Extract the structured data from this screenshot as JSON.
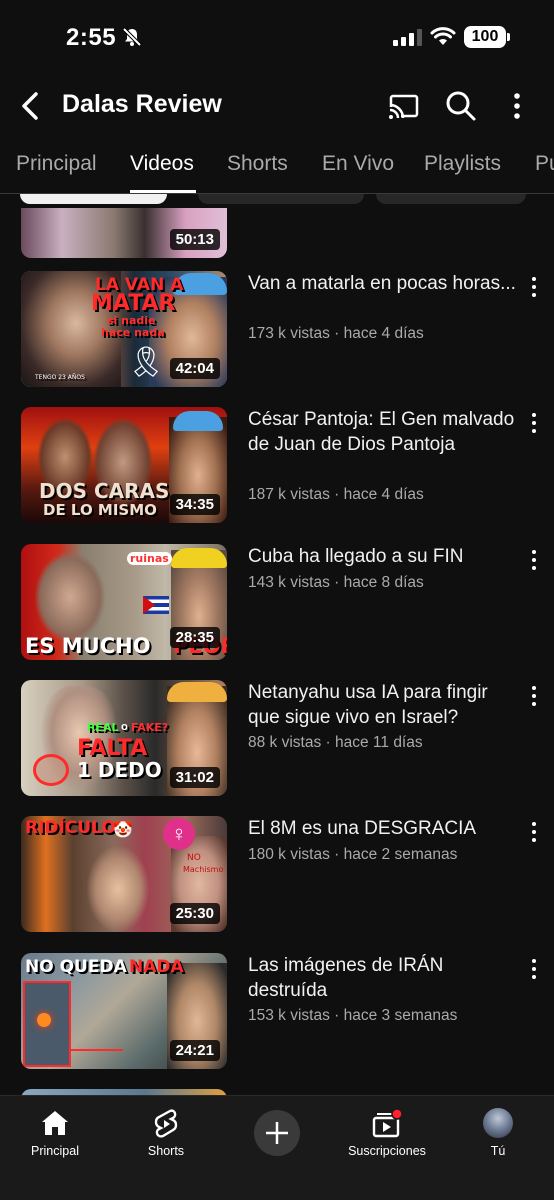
{
  "status_bar": {
    "time": "2:55",
    "battery": "100"
  },
  "header": {
    "channel_name": "Dalas Review"
  },
  "tabs": [
    {
      "label": "Principal",
      "active": false
    },
    {
      "label": "Videos",
      "active": true
    },
    {
      "label": "Shorts",
      "active": false
    },
    {
      "label": "En Vivo",
      "active": false
    },
    {
      "label": "Playlists",
      "active": false
    },
    {
      "label": "Pu",
      "active": false
    }
  ],
  "videos": [
    {
      "title": "",
      "meta": "",
      "duration": "50:13"
    },
    {
      "title": "Van a matarla en pocas horas...",
      "meta": "173 k vistas · hace 4 días",
      "duration": "42:04",
      "thumb_text": [
        "LA VAN A",
        "MATAR",
        "si nadie",
        "hace nada",
        "TENGO 23 AÑOS"
      ]
    },
    {
      "title": "César Pantoja: El Gen malvado de Juan de Dios Pantoja",
      "meta": "187 k vistas · hace 4 días",
      "duration": "34:35",
      "thumb_text": [
        "DOS CARAS",
        "DE LO MISMO"
      ]
    },
    {
      "title": "Cuba ha llegado a su FIN",
      "meta": "143 k vistas · hace 8 días",
      "duration": "28:35",
      "thumb_text": [
        "ES MUCHO",
        "PEOR",
        "ruinas"
      ]
    },
    {
      "title": "Netanyahu usa IA para fingir que sigue vivo en Israel?",
      "meta": "88 k vistas · hace 11 días",
      "duration": "31:02",
      "thumb_text": [
        "REAL",
        "O",
        "FAKE?",
        "FALTA",
        "1 DEDO"
      ]
    },
    {
      "title": "El 8M es una DESGRACIA",
      "meta": "180 k vistas · hace 2 semanas",
      "duration": "25:30",
      "thumb_text": [
        "RIDÍCULOS",
        "NO",
        "Machismo"
      ]
    },
    {
      "title": "Las imágenes de IRÁN destruída",
      "meta": "153 k vistas · hace 3 semanas",
      "duration": "24:21",
      "thumb_text": [
        "NO QUEDA",
        "NADA"
      ]
    }
  ],
  "bottom_nav": [
    {
      "label": "Principal",
      "icon": "home-icon"
    },
    {
      "label": "Shorts",
      "icon": "shorts-icon"
    },
    {
      "label": "",
      "icon": "plus-icon"
    },
    {
      "label": "Suscripciones",
      "icon": "subscriptions-icon"
    },
    {
      "label": "Tú",
      "icon": "avatar"
    }
  ],
  "colors": {
    "background": "#0f0f0f",
    "secondary_text": "#aaaaaa",
    "accent_red": "#ff0000"
  }
}
